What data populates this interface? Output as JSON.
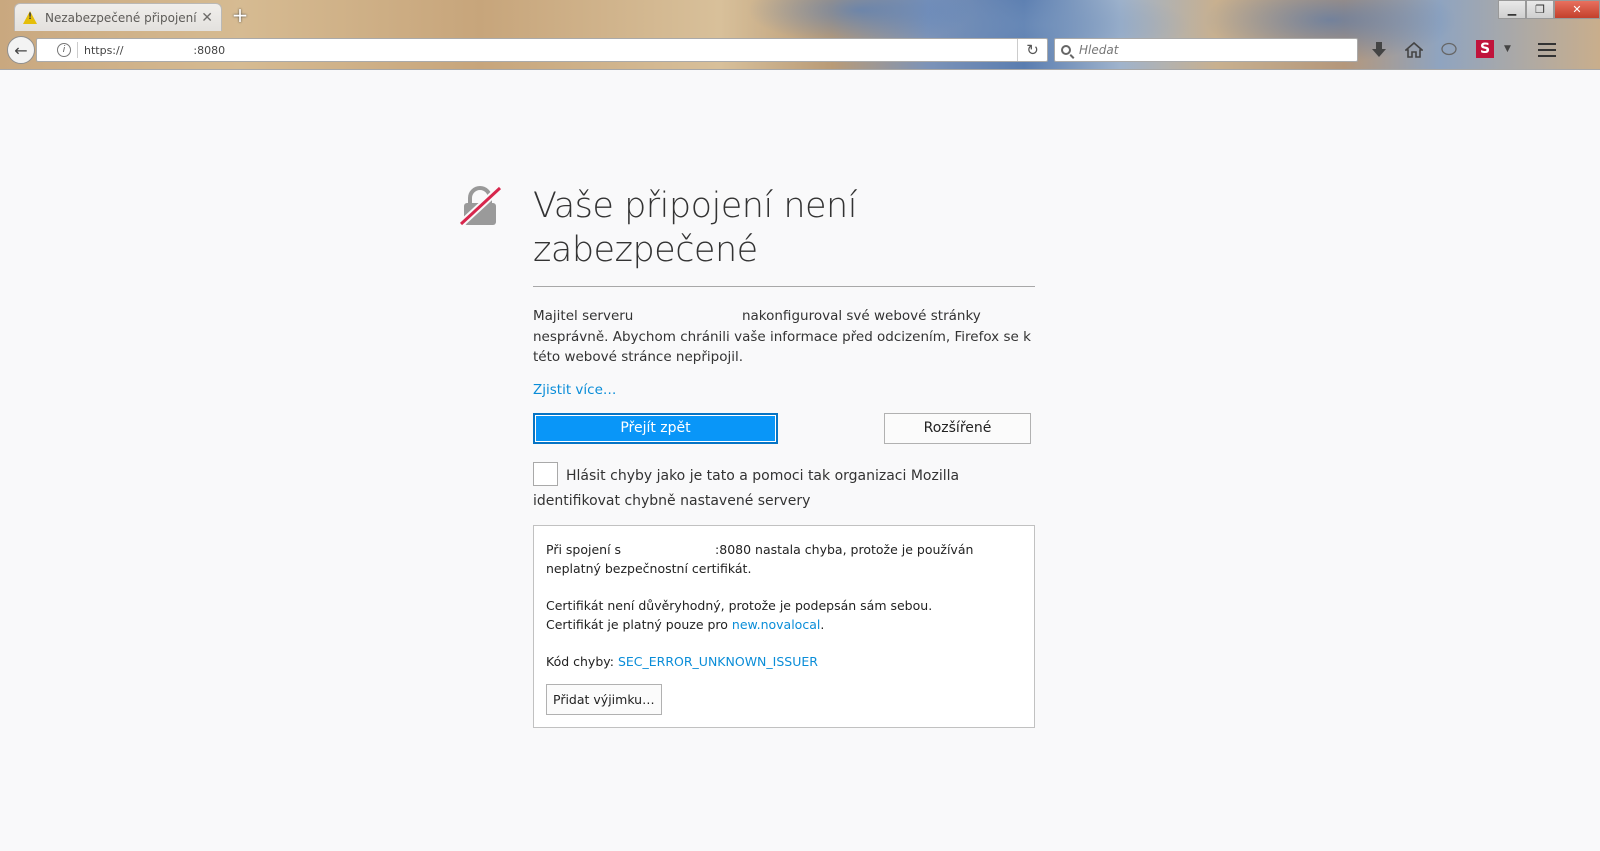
{
  "browser": {
    "tab": {
      "title": "Nezabezpečené připojení"
    },
    "new_tab_label": "+",
    "window_buttons": {
      "minimize": "▁",
      "restore": "❐",
      "close": "✕"
    },
    "url": {
      "text": "https://                    :8080"
    },
    "search": {
      "placeholder": "Hledat"
    },
    "toolbar_icons": [
      "download-icon",
      "home-icon",
      "chat-icon",
      "s-extension-icon",
      "menu-icon"
    ],
    "extension_label": "S"
  },
  "error_page": {
    "title": "Vaše připojení není zabezpečené",
    "description_before": "Majitel serveru",
    "description_after": "nakonfiguroval své webové stránky nesprávně. Abychom chránili vaše informace před odcizením, Firefox se k této webové stránce nepřipojil.",
    "learn_more": "Zjistit více…",
    "go_back_button": "Přejít zpět",
    "advanced_button": "Rozšířené",
    "report_checkbox_label": "Hlásit chyby jako je tato a pomoci tak organizaci Mozilla identifikovat chybně nastavené servery",
    "details": {
      "line1_before": "Při spojení s",
      "line1_after": ":8080 nastala chyba, protože je používán neplatný bezpečnostní certifikát.",
      "self_signed": "Certifikát není důvěryhodný, protože je podepsán sám sebou.",
      "valid_for_prefix": "Certifikát je platný pouze pro",
      "valid_for_domain": "new.novalocal",
      "valid_for_suffix": ".",
      "error_code_label": "Kód chyby:",
      "error_code": "SEC_ERROR_UNKNOWN_ISSUER",
      "add_exception_button": "Přidat výjimku…"
    }
  },
  "colors": {
    "primary_button": "#0996f8",
    "link": "#0a8dd8",
    "lock_slash": "#d7264c"
  }
}
